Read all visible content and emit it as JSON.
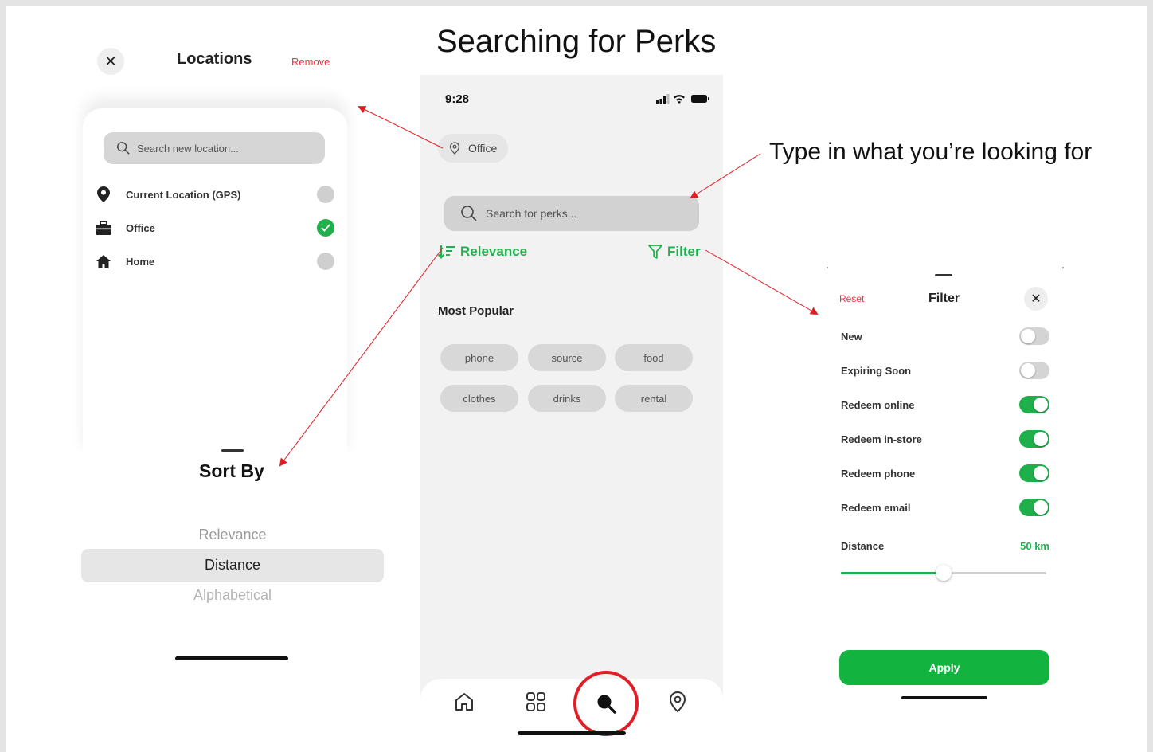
{
  "slide": {
    "title": "Searching for Perks",
    "caption": "Type in what you’re looking for"
  },
  "locations": {
    "title": "Locations",
    "remove_label": "Remove",
    "search_placeholder": "Search new location...",
    "items": [
      {
        "label": "Current Location (GPS)",
        "icon": "map-pin-icon",
        "selected": false
      },
      {
        "label": "Office",
        "icon": "briefcase-icon",
        "selected": true
      },
      {
        "label": "Home",
        "icon": "home-icon",
        "selected": false
      }
    ]
  },
  "sort_by": {
    "title": "Sort By",
    "options": [
      "Relevance",
      "Distance",
      "Alphabetical"
    ],
    "selected": "Distance"
  },
  "phone": {
    "time": "9:28",
    "location_chip": "Office",
    "search_placeholder": "Search for perks...",
    "sort_label": "Relevance",
    "filter_label": "Filter",
    "most_popular_title": "Most Popular",
    "chips": [
      "phone",
      "source",
      "food",
      "clothes",
      "drinks",
      "rental"
    ],
    "tabs": [
      "home-icon",
      "grid-icon",
      "search-icon",
      "location-pin-icon"
    ],
    "active_tab": "search-icon"
  },
  "filter": {
    "reset_label": "Reset",
    "title": "Filter",
    "toggles": [
      {
        "label": "New",
        "on": false
      },
      {
        "label": "Expiring Soon",
        "on": false
      },
      {
        "label": "Redeem online",
        "on": true
      },
      {
        "label": "Redeem in-store",
        "on": true
      },
      {
        "label": "Redeem phone",
        "on": true
      },
      {
        "label": "Redeem email",
        "on": true
      }
    ],
    "distance_label": "Distance",
    "distance_value": "50 km",
    "distance_fraction": 0.5,
    "apply_label": "Apply"
  },
  "colors": {
    "accent_green": "#1fb04c",
    "remove_red": "#ee3344",
    "highlight_ring": "#e01e26"
  }
}
